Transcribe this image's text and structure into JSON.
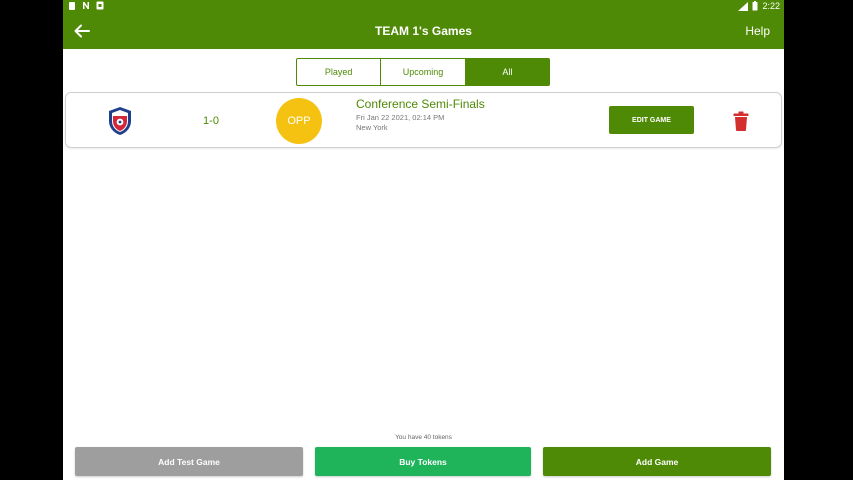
{
  "status_bar": {
    "time": "2:22"
  },
  "app_bar": {
    "title": "TEAM 1's Games",
    "help_label": "Help"
  },
  "filter_tabs": [
    {
      "label": "Played",
      "active": false
    },
    {
      "label": "Upcoming",
      "active": false
    },
    {
      "label": "All",
      "active": true
    }
  ],
  "games": [
    {
      "score": "1-0",
      "opponent_badge": "OPP",
      "name": "Conference Semi-Finals",
      "datetime": "Fri Jan 22 2021, 02:14 PM",
      "location": "New York",
      "edit_label": "EDIT GAME"
    }
  ],
  "tokens_text": "You have 40 tokens",
  "bottom_buttons": {
    "add_test_game": "Add Test Game",
    "buy_tokens": "Buy Tokens",
    "add_game": "Add Game"
  },
  "colors": {
    "primary": "#4f8a06",
    "opponent_badge": "#f5c211",
    "delete": "#d32f2f",
    "add_test_game_bg": "#9e9e9e",
    "buy_tokens_bg": "#1fb45a"
  }
}
